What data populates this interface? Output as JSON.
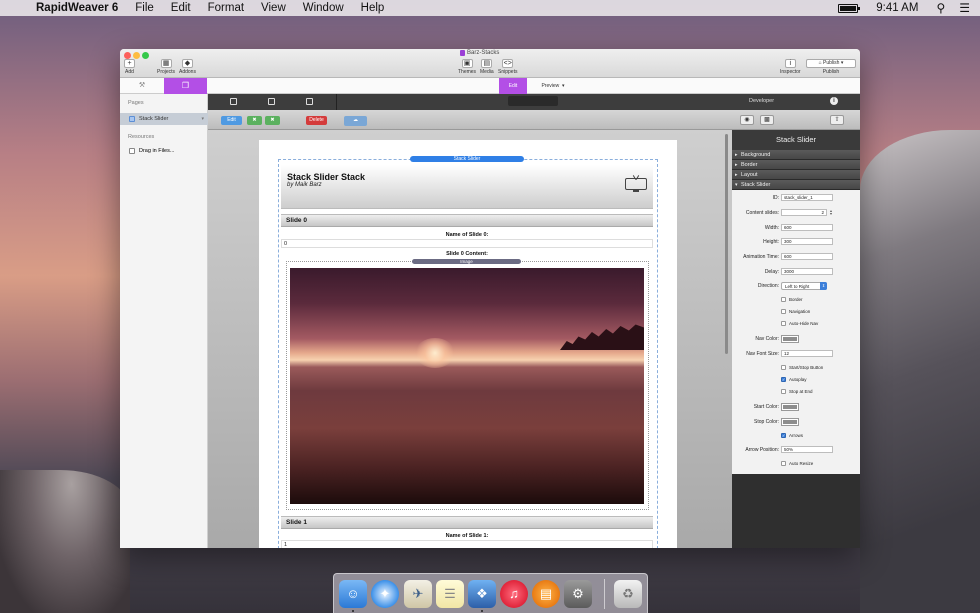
{
  "menubar": {
    "app_name": "RapidWeaver 6",
    "menus": [
      "File",
      "Edit",
      "Format",
      "View",
      "Window",
      "Help"
    ],
    "clock": "9:41 AM"
  },
  "window": {
    "title": "Barz-Stacks",
    "toolbar": {
      "add": "Add",
      "projects": "Projects",
      "addons": "Addons",
      "themes": "Themes",
      "media": "Media",
      "snippets": "Snippets",
      "inspector": "Inspector",
      "publish": "Publish",
      "publish_btn": "Publish"
    },
    "modes": {
      "edit": "Edit",
      "preview": "Preview"
    }
  },
  "sidebar": {
    "pages_header": "Pages",
    "page_item": "Stack Slider",
    "resources_header": "Resources",
    "resources_item": "Drag in Files..."
  },
  "editor": {
    "toolbar": {
      "edit": "Edit",
      "delete": "Delete"
    },
    "stack_tag": "Stack Slider",
    "header_title": "Stack Slider Stack",
    "header_subtitle": "by Maik Barz",
    "slide0": {
      "title": "Slide 0",
      "name_label": "Name of Slide 0:",
      "name_value": "0",
      "content_label": "Slide 0 Content:",
      "image_tag": "Image"
    },
    "slide1": {
      "title": "Slide 1",
      "name_label": "Name of Slide 1:",
      "name_value": "1"
    }
  },
  "inspector": {
    "toolbar_title": "Developer",
    "title": "Stack Slider",
    "sections": [
      "Background",
      "Border",
      "Layout",
      "Stack Slider"
    ],
    "props": {
      "id_label": "ID:",
      "id_value": "stack_slider_1",
      "content_slides_label": "Content slides:",
      "content_slides_value": "2",
      "width_label": "Width:",
      "width_value": "600",
      "height_label": "Height:",
      "height_value": "300",
      "animation_time_label": "Animation Time:",
      "animation_time_value": "600",
      "delay_label": "Delay:",
      "delay_value": "3000",
      "direction_label": "Direction:",
      "direction_value": "Left to Right",
      "border_cb": "Border",
      "navigation_cb": "Navigation",
      "autohide_cb": "Auto-Hide Nav",
      "nav_color_label": "Nav Color:",
      "nav_font_size_label": "Nav Font Size:",
      "nav_font_size_value": "12",
      "startstop_cb": "Start/Stop Button",
      "autoplay_cb": "Autoplay",
      "stop_at_end_cb": "Stop at End",
      "start_color_label": "Start Color:",
      "stop_color_label": "Stop Color:",
      "arrows_cb": "Arrows",
      "arrow_position_label": "Arrow Position:",
      "arrow_position_value": "50%",
      "auto_resize_cb": "Auto Resize"
    }
  }
}
